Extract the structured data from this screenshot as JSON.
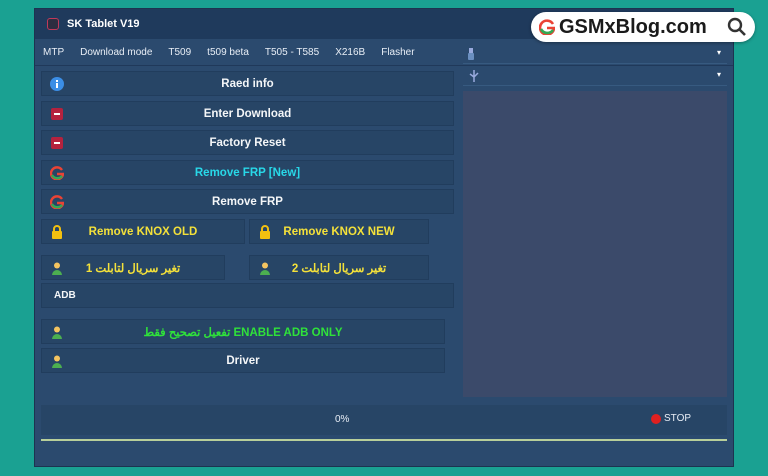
{
  "window": {
    "title": "SK Tablet V19"
  },
  "tabs": [
    "MTP",
    "Download mode",
    "T509",
    "t509 beta",
    "T505 - T585",
    "X216B",
    "Flasher"
  ],
  "actions": {
    "read_info": "Raed info",
    "enter_download": "Enter Download",
    "factory_reset": "Factory Reset",
    "remove_frp_new": "Remove FRP [New]",
    "remove_frp": "Remove FRP",
    "remove_knox_old": "Remove KNOX  OLD",
    "remove_knox_new": "Remove KNOX NEW",
    "change_serial_1": "تغير سريال لتابلت 1",
    "change_serial_2": "تغير سريال لتابلت 2",
    "adb_section": "ADB",
    "enable_adb_only": "تفعيل تصحيح  فقط  ENABLE ADB ONLY",
    "driver": "Driver"
  },
  "status": {
    "progress": "0%",
    "stop_label": "STOP"
  },
  "watermark": {
    "text": "GSMxBlog.com"
  },
  "colors": {
    "background": "#1aa192",
    "window": "#2b4a6e",
    "accent_cyan": "#28d8e8",
    "accent_yellow": "#f4e13a",
    "accent_green": "#2fe23a",
    "stop_red": "#e02020"
  }
}
